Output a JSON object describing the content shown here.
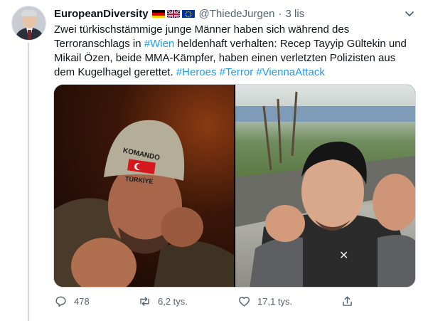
{
  "author": {
    "display_name": "EuropeanDiversity",
    "handle": "@ThiedeJurgen",
    "separator": "·",
    "time": "3 lis",
    "flags": [
      "germany-flag",
      "uk-flag",
      "eu-flag"
    ]
  },
  "tweet": {
    "text_parts": {
      "p1": "Zwei türkischstämmige junge Männer haben sich während des Terroranschlags in ",
      "link1": "#Wien",
      "p2": " heldenhaft verhalten: Recep Tayyip Gültekin und Mikail Özen, beide MMA-Kämpfer, haben einen verletzten Polizisten aus dem Kugelhagel gerettet. ",
      "link2": "#Heroes",
      "link3": "#Terror",
      "link4": "#ViennaAttack"
    }
  },
  "media": {
    "photos": [
      {
        "name": "photo-left",
        "cap_text_top": "KOMANDO",
        "cap_text_bottom": "TÜRKİYE"
      },
      {
        "name": "photo-right"
      }
    ]
  },
  "actions": {
    "reply_count": "478",
    "retweet_count": "6,2 tys.",
    "like_count": "17,1 tys."
  },
  "colors": {
    "link": "#1d9bf0",
    "secondary_text": "#536471",
    "primary_text": "#0f1419"
  }
}
